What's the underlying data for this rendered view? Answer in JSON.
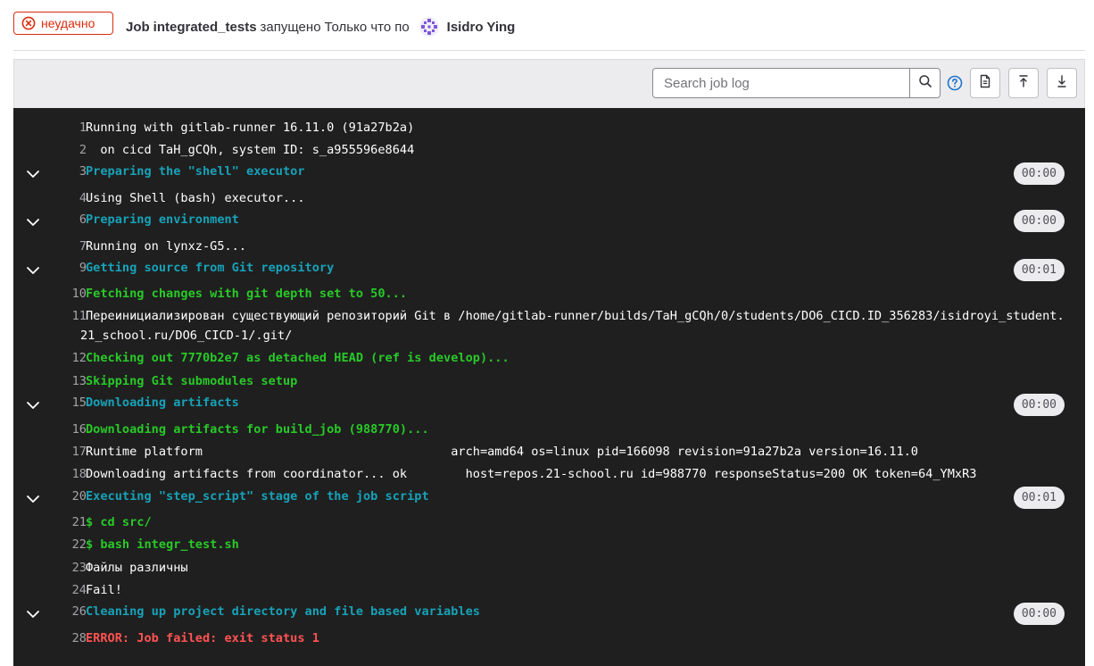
{
  "header": {
    "status": "неудачно",
    "job_label": "Job",
    "job_name": "integrated_tests",
    "started_text": "запущено",
    "time_text": "Только что",
    "by_text": "по",
    "user_name": "Isidro Ying"
  },
  "toolbar": {
    "search_placeholder": "Search job log",
    "icons": [
      "search-icon",
      "help-icon",
      "raw-log-icon",
      "scroll-to-top-icon",
      "scroll-to-bottom-icon"
    ]
  },
  "colors": {
    "failed": "#dd2b0e",
    "section_header": "#17a2b8",
    "success_text": "#28c928",
    "error_text": "#ff5252",
    "log_background": "#1f1f1f"
  },
  "log": {
    "lines": [
      {
        "num": "1",
        "text": "Running with gitlab-runner 16.11.0 (91a27b2a)",
        "style": "white"
      },
      {
        "num": "2",
        "text": "  on cicd TaH_gCQh, system ID: s_a955596e8644",
        "style": "white"
      },
      {
        "num": "3",
        "text": "Preparing the \"shell\" executor",
        "style": "cyan",
        "section": true,
        "duration": "00:00"
      },
      {
        "num": "4",
        "text": "Using Shell (bash) executor...",
        "style": "white"
      },
      {
        "num": "6",
        "text": "Preparing environment",
        "style": "cyan",
        "section": true,
        "duration": "00:00"
      },
      {
        "num": "7",
        "text": "Running on lynxz-G5...",
        "style": "white"
      },
      {
        "num": "9",
        "text": "Getting source from Git repository",
        "style": "cyan",
        "section": true,
        "duration": "00:01"
      },
      {
        "num": "10",
        "text": "Fetching changes with git depth set to 50...",
        "style": "green"
      },
      {
        "num": "11",
        "text": "Переинициализирован существующий репозиторий Git в /home/gitlab-runner/builds/TaH_gCQh/0/students/DO6_CICD.ID_356283/isidroyi_student.21_school.ru/DO6_CICD-1/.git/",
        "style": "white",
        "wrap": true
      },
      {
        "num": "12",
        "text": "Checking out 7770b2e7 as detached HEAD (ref is develop)...",
        "style": "green"
      },
      {
        "num": "13",
        "text": "Skipping Git submodules setup",
        "style": "green"
      },
      {
        "num": "15",
        "text": "Downloading artifacts",
        "style": "cyan",
        "section": true,
        "duration": "00:00"
      },
      {
        "num": "16",
        "text": "Downloading artifacts for build_job (988770)...",
        "style": "green"
      },
      {
        "num": "17",
        "text": "Runtime platform                                  arch=amd64 os=linux pid=166098 revision=91a27b2a version=16.11.0",
        "style": "white"
      },
      {
        "num": "18",
        "text": "Downloading artifacts from coordinator... ok        host=repos.21-school.ru id=988770 responseStatus=200 OK token=64_YMxR3",
        "style": "white"
      },
      {
        "num": "20",
        "text": "Executing \"step_script\" stage of the job script",
        "style": "cyan",
        "section": true,
        "duration": "00:01"
      },
      {
        "num": "21",
        "text": "$ cd src/",
        "style": "green"
      },
      {
        "num": "22",
        "text": "$ bash integr_test.sh",
        "style": "green"
      },
      {
        "num": "23",
        "text": "Файлы различны",
        "style": "white"
      },
      {
        "num": "24",
        "text": "Fail!",
        "style": "white"
      },
      {
        "num": "26",
        "text": "Cleaning up project directory and file based variables",
        "style": "cyan",
        "section": true,
        "duration": "00:00"
      },
      {
        "num": "28",
        "text": "ERROR: Job failed: exit status 1",
        "style": "red"
      }
    ]
  }
}
